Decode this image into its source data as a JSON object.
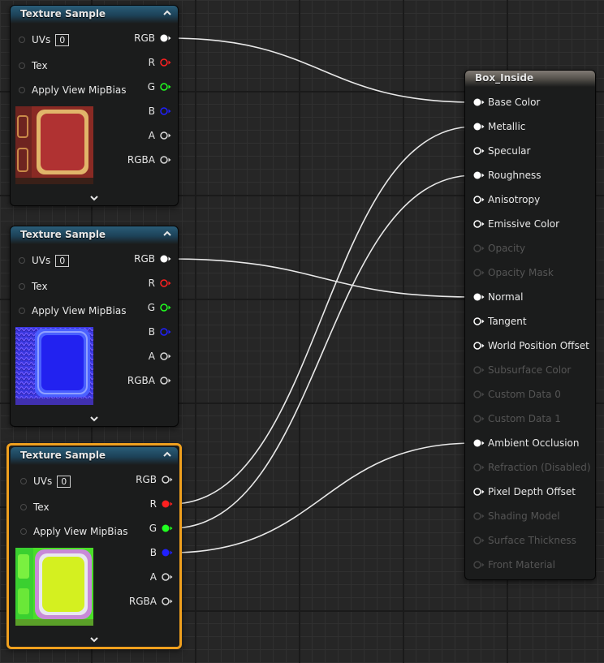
{
  "colors": {
    "selected_border": "#f0a01e",
    "header_blue": "#1c4157",
    "pin_red": "#ff2020",
    "pin_green": "#20ff20",
    "pin_blue": "#2020ff",
    "wire": "#e8e8e8"
  },
  "texture_nodes": [
    {
      "title": "Texture Sample",
      "uv_label": "UVs",
      "uv_value": "0",
      "tex_label": "Tex",
      "mip_label": "Apply View MipBias",
      "outputs": {
        "rgb": "RGB",
        "r": "R",
        "g": "G",
        "b": "B",
        "a": "A",
        "rgba": "RGBA"
      },
      "thumbnail": "base-color-texture",
      "selected": false
    },
    {
      "title": "Texture Sample",
      "uv_label": "UVs",
      "uv_value": "0",
      "tex_label": "Tex",
      "mip_label": "Apply View MipBias",
      "outputs": {
        "rgb": "RGB",
        "r": "R",
        "g": "G",
        "b": "B",
        "a": "A",
        "rgba": "RGBA"
      },
      "thumbnail": "normal-map-texture",
      "selected": false
    },
    {
      "title": "Texture Sample",
      "uv_label": "UVs",
      "uv_value": "0",
      "tex_label": "Tex",
      "mip_label": "Apply View MipBias",
      "outputs": {
        "rgb": "RGB",
        "r": "R",
        "g": "G",
        "b": "B",
        "a": "A",
        "rgba": "RGBA"
      },
      "thumbnail": "orm-packed-texture",
      "selected": true
    }
  ],
  "material_node": {
    "title": "Box_Inside",
    "inputs": [
      {
        "label": "Base Color",
        "enabled": true,
        "connected": true
      },
      {
        "label": "Metallic",
        "enabled": true,
        "connected": true
      },
      {
        "label": "Specular",
        "enabled": true,
        "connected": false
      },
      {
        "label": "Roughness",
        "enabled": true,
        "connected": true
      },
      {
        "label": "Anisotropy",
        "enabled": true,
        "connected": false
      },
      {
        "label": "Emissive Color",
        "enabled": true,
        "connected": false
      },
      {
        "label": "Opacity",
        "enabled": false,
        "connected": false
      },
      {
        "label": "Opacity Mask",
        "enabled": false,
        "connected": false
      },
      {
        "label": "Normal",
        "enabled": true,
        "connected": true
      },
      {
        "label": "Tangent",
        "enabled": true,
        "connected": false
      },
      {
        "label": "World Position Offset",
        "enabled": true,
        "connected": false
      },
      {
        "label": "Subsurface Color",
        "enabled": false,
        "connected": false
      },
      {
        "label": "Custom Data 0",
        "enabled": false,
        "connected": false
      },
      {
        "label": "Custom Data 1",
        "enabled": false,
        "connected": false
      },
      {
        "label": "Ambient Occlusion",
        "enabled": true,
        "connected": true
      },
      {
        "label": "Refraction (Disabled)",
        "enabled": false,
        "connected": false
      },
      {
        "label": "Pixel Depth Offset",
        "enabled": true,
        "connected": false
      },
      {
        "label": "Shading Model",
        "enabled": false,
        "connected": false
      },
      {
        "label": "Surface Thickness",
        "enabled": false,
        "connected": false
      },
      {
        "label": "Front Material",
        "enabled": false,
        "connected": false
      }
    ]
  },
  "connections": [
    {
      "from_node": 0,
      "from_pin": "rgb",
      "to_input": "Base Color"
    },
    {
      "from_node": 1,
      "from_pin": "rgb",
      "to_input": "Normal"
    },
    {
      "from_node": 2,
      "from_pin": "r",
      "to_input": "Metallic"
    },
    {
      "from_node": 2,
      "from_pin": "g",
      "to_input": "Roughness"
    },
    {
      "from_node": 2,
      "from_pin": "b",
      "to_input": "Ambient Occlusion"
    }
  ]
}
